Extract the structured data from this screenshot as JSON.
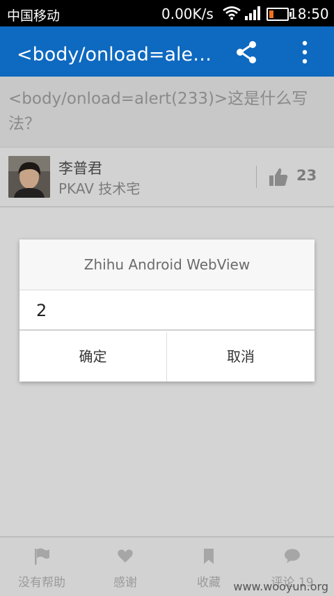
{
  "status": {
    "carrier": "中国移动",
    "speed": "0.00K/s",
    "time": "18:50"
  },
  "appbar": {
    "title": "<body/onload=alert(233)>这是什么写法？",
    "share_icon": "share-icon",
    "more_icon": "more-vertical-icon"
  },
  "question": {
    "text": "<body/onload=alert(233)>这是什么写法？"
  },
  "author": {
    "name": "李普君",
    "bio": "PKAV 技术宅",
    "likes": "23"
  },
  "dialog": {
    "title": "Zhihu Android WebView",
    "input_value": "2",
    "ok_label": "确定",
    "cancel_label": "取消"
  },
  "bottom_nav": [
    {
      "label": "没有帮助",
      "icon": "flag-icon"
    },
    {
      "label": "感谢",
      "icon": "heart-icon"
    },
    {
      "label": "收藏",
      "icon": "bookmark-icon"
    },
    {
      "label": "评论 19",
      "icon": "comment-icon"
    }
  ],
  "watermark": "www.wooyun.org",
  "colors": {
    "appbar": "#0e69c0",
    "battery": "#f2711c"
  }
}
